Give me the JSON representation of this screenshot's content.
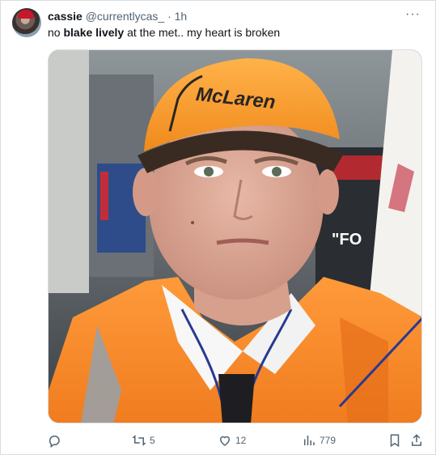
{
  "tweet": {
    "display_name": "cassie",
    "handle": "@currentlycas_",
    "separator": "·",
    "time": "1h",
    "more": "···",
    "text_before": "no ",
    "text_bold": "blake lively",
    "text_after": " at the met.. my heart is broken"
  },
  "media": {
    "logo_text": "McLaren"
  },
  "actions": {
    "reposts": "5",
    "likes": "12",
    "views": "779"
  },
  "icons": [
    "reply-icon",
    "repost-icon",
    "like-icon",
    "views-icon",
    "bookmark-icon",
    "share-icon"
  ]
}
